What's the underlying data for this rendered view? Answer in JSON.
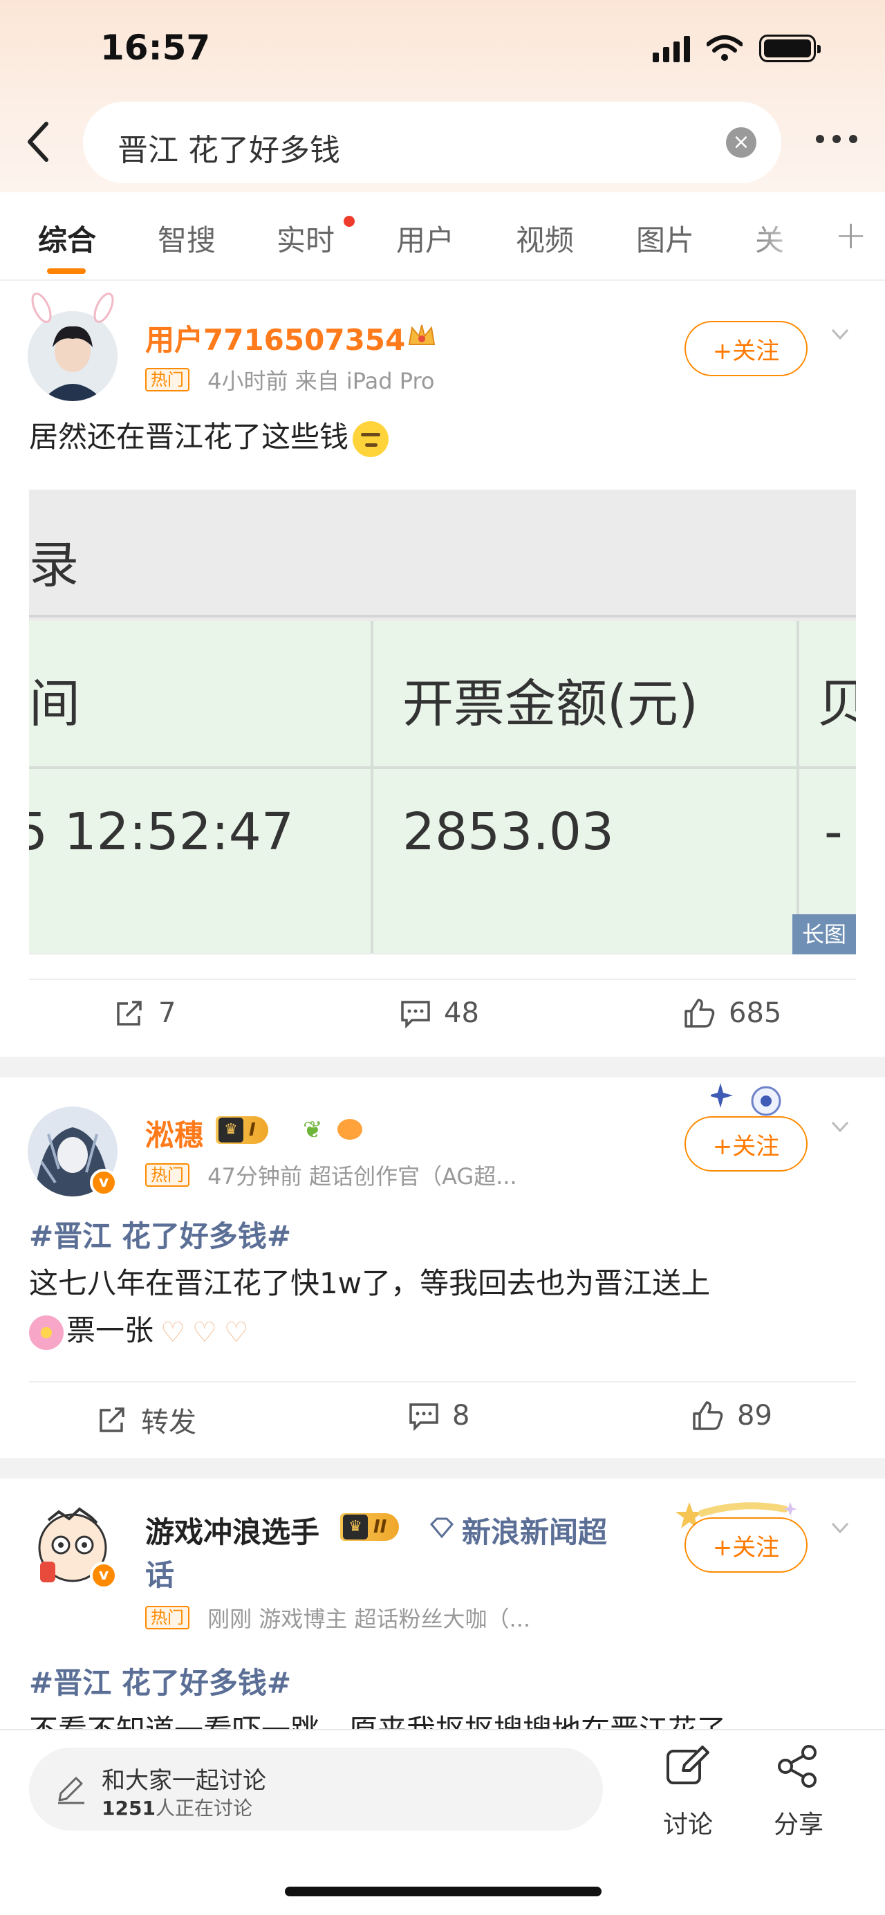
{
  "status": {
    "time": "16:57"
  },
  "header": {
    "search_query": "晋江 花了好多钱"
  },
  "tabs": [
    "综合",
    "智搜",
    "实时",
    "用户",
    "视频",
    "图片",
    "关"
  ],
  "posts": [
    {
      "username": "用户7716507354",
      "hot_label": "热门",
      "meta": "4小时前  来自 iPad Pro",
      "follow_label": "+关注",
      "text": "居然还在晋江花了这些钱",
      "image": {
        "top_text": "录",
        "header_left": "间",
        "header_right": "开票金额(元)",
        "header_cut": "贝",
        "row_left": "5 12:52:47",
        "row_right": "2853.03",
        "row_cut": "-",
        "badge": "长图"
      },
      "actions": {
        "repost": "7",
        "comments": "48",
        "likes": "685"
      }
    },
    {
      "username": "淞穗",
      "level_badge": "I",
      "hot_label": "热门",
      "meta": "47分钟前  超话创作官（AG超...",
      "follow_label": "+关注",
      "topic": "#晋江 花了好多钱#",
      "text_line1": "这七八年在晋江花了快1w了，等我回去也为晋江送上",
      "text_line2": "票一张",
      "actions": {
        "repost": "转发",
        "comments": "8",
        "likes": "89"
      }
    },
    {
      "username": "游戏冲浪选手",
      "level_badge": "II",
      "extra_line1": "新浪新闻超",
      "extra_line2": "话",
      "hot_label": "热门",
      "meta": "刚刚  游戏博主 超话粉丝大咖（...",
      "follow_label": "+关注",
      "topic": "#晋江 花了好多钱#",
      "text_partial": "不看不知道一看吓一跳，原来我抠抠搜搜地在晋江花了"
    }
  ],
  "bottom_bar": {
    "discuss_title": "和大家一起讨论",
    "discuss_count": "1251",
    "discuss_suffix": "人正在讨论",
    "discuss_btn": "讨论",
    "share_btn": "分享"
  },
  "colors": {
    "accent": "#ff8200",
    "topic": "#5b6f96",
    "username_orange": "#ff7a1a"
  }
}
